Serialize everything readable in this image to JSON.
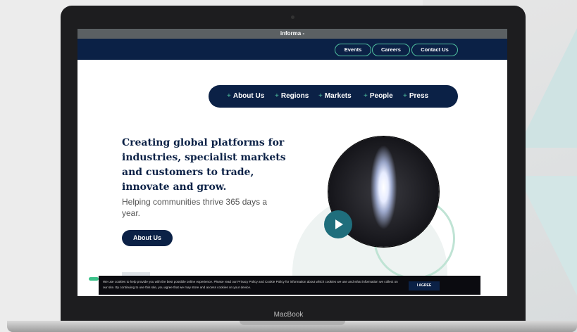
{
  "site": {
    "brand": "informa",
    "top_nav": [
      "Events",
      "Careers",
      "Contact Us"
    ],
    "menu": [
      {
        "label": "About Us"
      },
      {
        "label": "Regions"
      },
      {
        "label": "Markets"
      },
      {
        "label": "People"
      },
      {
        "label": "Press"
      }
    ],
    "hero": {
      "headline": "Creating global platforms for industries, specialist markets and customers to trade, innovate and grow.",
      "subtext": "Helping communities thrive 365 days a year.",
      "cta": "About Us"
    },
    "cookie": {
      "text": "We use cookies to help provide you with the best possible online experience. Please read our Privacy Policy and Cookie Policy for information about which cookies we use and what information we collect on our site. By continuing to use this site, you agree that we may store and access cookies on your device.",
      "button": "I AGREE"
    }
  },
  "device": {
    "label": "MacBook"
  },
  "icons": {
    "plus": "plus-icon",
    "play": "play-icon"
  },
  "colors": {
    "navy": "#0b2146",
    "accent_green": "#4fbf9f",
    "teal": "#1f6e7c"
  }
}
